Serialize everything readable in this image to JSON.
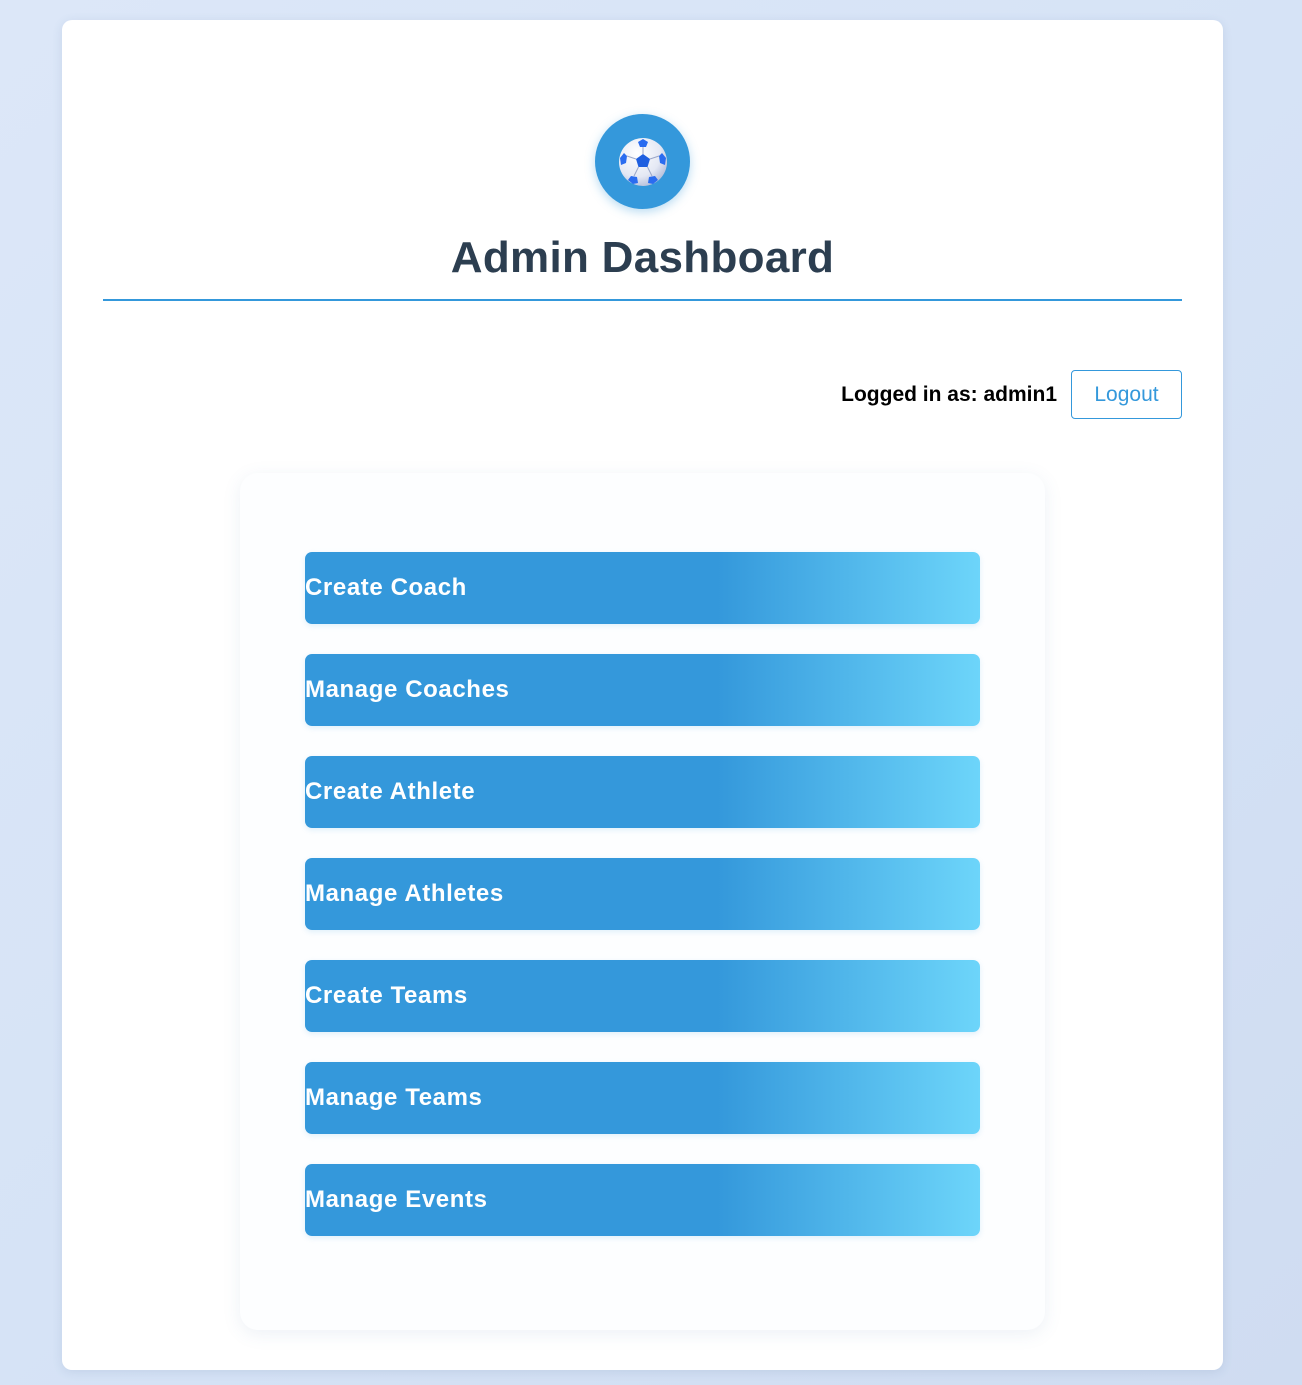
{
  "header": {
    "logo_icon": "soccer-ball-icon",
    "title": "Admin Dashboard"
  },
  "user_bar": {
    "label": "Logged in as: admin1",
    "logout_label": "Logout"
  },
  "menu": {
    "items": [
      {
        "label": "Create Coach"
      },
      {
        "label": "Manage Coaches"
      },
      {
        "label": "Create Athlete"
      },
      {
        "label": "Manage Athletes"
      },
      {
        "label": "Create Teams"
      },
      {
        "label": "Manage Teams"
      },
      {
        "label": "Manage Events"
      }
    ]
  },
  "colors": {
    "accent": "#3498db",
    "gradient_end": "#6dd5fa",
    "title_text": "#2c3e50",
    "background": "#dce7f8"
  }
}
